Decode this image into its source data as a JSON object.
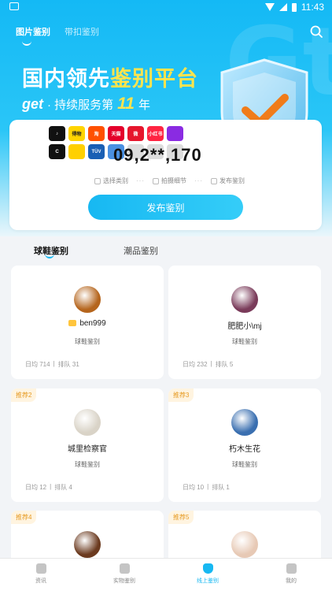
{
  "status_bar": {
    "time": "11:43"
  },
  "top_tabs": [
    {
      "label": "图片鉴别",
      "active": true
    },
    {
      "label": "带扣鉴别",
      "active": false
    }
  ],
  "banner": {
    "headline_prefix": "国内领先",
    "headline_accent": "鉴别平台",
    "brand": "get",
    "sub_prefix": "· 持续服务第",
    "years": "11",
    "sub_suffix": "年"
  },
  "panel": {
    "logos": [
      {
        "icon": "tiktok",
        "text": "♪",
        "color": "#111111"
      },
      {
        "icon": "dewu",
        "text": "得物",
        "color": "#ffd400"
      },
      {
        "icon": "taobao",
        "text": "淘",
        "color": "#ff5000"
      },
      {
        "icon": "tmall",
        "text": "天猫",
        "color": "#e4002b"
      },
      {
        "icon": "weibo",
        "text": "微",
        "color": "#e6162d"
      },
      {
        "icon": "xiaohongshu",
        "text": "小红书",
        "color": "#ff2442"
      },
      {
        "icon": "other-purple",
        "text": "",
        "color": "#8a2be2"
      },
      {
        "icon": "kuaishou",
        "text": "C",
        "color": "#111111"
      },
      {
        "icon": "yellow-tile",
        "text": "",
        "color": "#ffd000"
      },
      {
        "icon": "tuv",
        "text": "TÜV",
        "color": "#1a5fb4"
      },
      {
        "icon": "partner-flower",
        "text": "",
        "color": "#4a90e2"
      },
      {
        "icon": "partner-grey",
        "text": "",
        "color": "#dddddd"
      },
      {
        "icon": "partner-grey2",
        "text": "",
        "color": "#dddddd"
      },
      {
        "icon": "partner-grey3",
        "text": "",
        "color": "#dddddd"
      }
    ],
    "counter": "09,2**,170",
    "steps": [
      "选择类别",
      "拍摄细节",
      "发布鉴别"
    ],
    "publish_button": "发布鉴别"
  },
  "category_tabs": [
    {
      "label": "球鞋鉴别",
      "active": true
    },
    {
      "label": "潮品鉴别",
      "active": false
    }
  ],
  "experts": [
    {
      "name": "ben999",
      "type": "球鞋鉴别",
      "daily": "日均 714",
      "queue": "排队 31",
      "rank": "",
      "vip": true,
      "avatar_color": "#b5651d"
    },
    {
      "name": "肥肥小\\mj",
      "type": "球鞋鉴别",
      "daily": "日均 232",
      "queue": "排队 5",
      "rank": "",
      "vip": false,
      "avatar_color": "#7a3b5a"
    },
    {
      "name": "城里检察官",
      "type": "球鞋鉴别",
      "daily": "日均 12",
      "queue": "排队 4",
      "rank": "推荐2",
      "vip": false,
      "avatar_color": "#d9d3c7"
    },
    {
      "name": "朽木生花",
      "type": "球鞋鉴别",
      "daily": "日均 10",
      "queue": "排队 1",
      "rank": "推荐3",
      "vip": false,
      "avatar_color": "#3a6fb0"
    },
    {
      "name": "",
      "type": "",
      "daily": "",
      "queue": "",
      "rank": "推荐4",
      "vip": false,
      "avatar_color": "#6b3a1f"
    },
    {
      "name": "",
      "type": "",
      "daily": "",
      "queue": "",
      "rank": "推荐5",
      "vip": false,
      "avatar_color": "#e7c9b5"
    }
  ],
  "bottom_nav": [
    {
      "label": "资讯",
      "icon": "news-icon",
      "active": false
    },
    {
      "label": "实物鉴别",
      "icon": "box-icon",
      "active": false
    },
    {
      "label": "线上鉴别",
      "icon": "shield-icon",
      "active": true
    },
    {
      "label": "我的",
      "icon": "profile-icon",
      "active": false
    }
  ],
  "colors": {
    "accent": "#17b8f2",
    "headline_accent": "#ffe44d",
    "rank_text": "#e69a22"
  }
}
